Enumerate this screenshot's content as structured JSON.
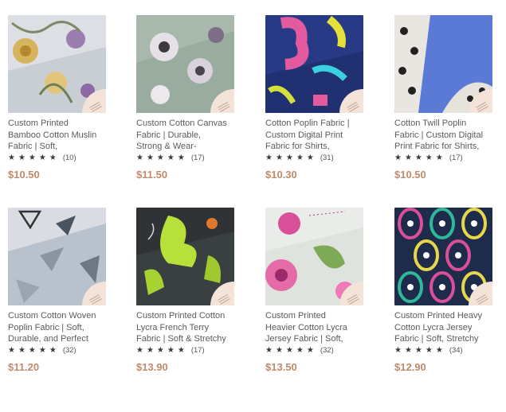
{
  "products": [
    {
      "title_lines": [
        "Custom Printed",
        "Bamboo Cotton Muslin",
        "Fabric | Soft,"
      ],
      "stars": "★★★★★",
      "reviews": "(10)",
      "price": "$10.50",
      "image": "floral-gray-fabric"
    },
    {
      "title_lines": [
        "Custom Cotton Canvas",
        "Fabric | Durable,",
        "Strong & Wear-"
      ],
      "stars": "★★★★★",
      "reviews": "(17)",
      "price": "$11.50",
      "image": "pansy-green-fabric"
    },
    {
      "title_lines": [
        "Cotton Poplin Fabric |",
        "Custom Digital Print",
        "Fabric for Shirts,"
      ],
      "stars": "★★★★★",
      "reviews": "(31)",
      "price": "$10.30",
      "image": "navy-letters-fabric"
    },
    {
      "title_lines": [
        "Cotton Twill Poplin",
        "Fabric | Custom Digital",
        "Print Fabric for Shirts,"
      ],
      "stars": "★★★★★",
      "reviews": "(17)",
      "price": "$10.50",
      "image": "blue-leopard-fabric"
    },
    {
      "title_lines": [
        "Custom Cotton Woven",
        "Poplin Fabric | Soft,",
        "Durable, and Perfect"
      ],
      "stars": "★★★★★",
      "reviews": "(32)",
      "price": "$11.20",
      "image": "geometric-gray-fabric"
    },
    {
      "title_lines": [
        "Custom Printed Cotton",
        "Lycra French Terry",
        "Fabric | Soft & Stretchy"
      ],
      "stars": "★★★★★",
      "reviews": "(17)",
      "price": "$13.90",
      "image": "lime-figures-fabric"
    },
    {
      "title_lines": [
        "Custom Printed",
        "Heavier Cotton Lycra",
        "Jersey Fabric | Soft,"
      ],
      "stars": "★★★★★",
      "reviews": "(32)",
      "price": "$13.50",
      "image": "pink-floral-fabric"
    },
    {
      "title_lines": [
        "Custom Printed Heavy",
        "Cotton Lycra Jersey",
        "Fabric | Soft, Stretchy"
      ],
      "stars": "★★★★★",
      "reviews": "(34)",
      "price": "$12.90",
      "image": "peacock-pattern-fabric"
    }
  ],
  "colors": {
    "price": "#c08a6b",
    "star": "#3b3b3b",
    "title": "#5b5b5b",
    "badge": "#f3e3d9"
  }
}
